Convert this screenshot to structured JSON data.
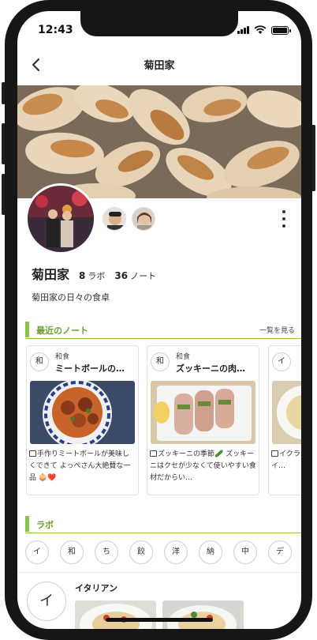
{
  "status": {
    "time": "12:43"
  },
  "header": {
    "title": "菊田家",
    "back_icon": "chevron-left-icon"
  },
  "profile": {
    "name": "菊田家",
    "labo_count": "8",
    "labo_label": "ラボ",
    "note_count": "36",
    "note_label": "ノート",
    "description": "菊田家の日々の食卓"
  },
  "recent_notes": {
    "title": "最近のノート",
    "see_all": "一覧を見る",
    "cards": [
      {
        "cat_char": "和",
        "category": "和食",
        "title": "ミートボールの…",
        "text": "手作りミートボールが美味しくできて よっぺさん大絶賛な一品 🧅❤️"
      },
      {
        "cat_char": "和",
        "category": "和食",
        "title": "ズッキーニの肉…",
        "text": "ズッキーニの季節🥒 ズッキーニはクセが少なくて使いやすい食材だからい…"
      },
      {
        "cat_char": "イ",
        "category": "",
        "title": "",
        "text": "イクラ… 持ち薄め… のがポイ…"
      }
    ]
  },
  "labo_section": {
    "title": "ラボ",
    "categories": [
      "イ",
      "和",
      "ち",
      "餃",
      "洋",
      "納",
      "中",
      "デ"
    ],
    "first": {
      "char": "イ",
      "name": "イタリアン"
    }
  },
  "colors": {
    "accent": "#8cc34a",
    "accent_text": "#6b9e2e"
  }
}
